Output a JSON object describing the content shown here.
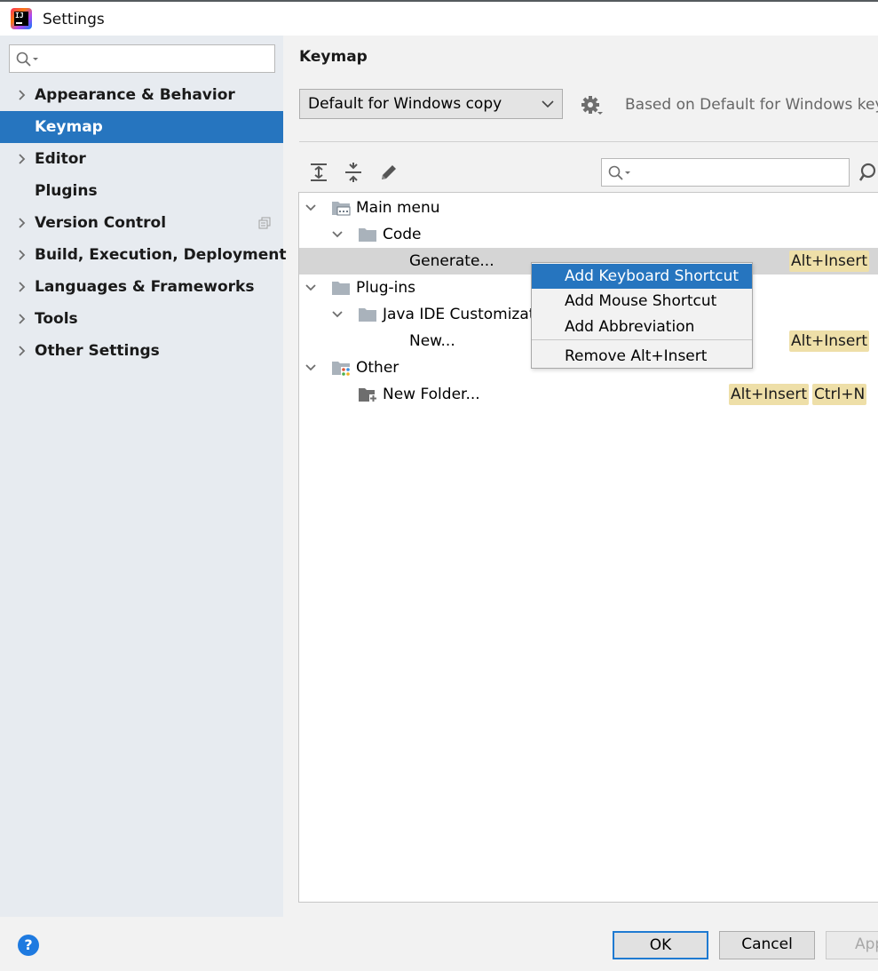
{
  "window": {
    "title": "Settings",
    "logo_text": "IJ"
  },
  "sidebar": {
    "search_placeholder": "",
    "items": [
      {
        "label": "Appearance & Behavior",
        "expandable": true
      },
      {
        "label": "Keymap",
        "expandable": false,
        "selected": true
      },
      {
        "label": "Editor",
        "expandable": true
      },
      {
        "label": "Plugins",
        "expandable": false
      },
      {
        "label": "Version Control",
        "expandable": true
      },
      {
        "label": "Build, Execution, Deployment",
        "expandable": true
      },
      {
        "label": "Languages & Frameworks",
        "expandable": true
      },
      {
        "label": "Tools",
        "expandable": true
      },
      {
        "label": "Other Settings",
        "expandable": true
      }
    ]
  },
  "main": {
    "title": "Keymap",
    "keymap_select": "Default for Windows copy",
    "based_on": "Based on Default for Windows keym",
    "tree_search_placeholder": ""
  },
  "tree": {
    "rows": [
      {
        "label": "Main menu"
      },
      {
        "label": "Code"
      },
      {
        "label": "Generate...",
        "shortcut": "Alt+Insert"
      },
      {
        "label": "Plug-ins"
      },
      {
        "label": "Java IDE Customizati"
      },
      {
        "label": "New...",
        "shortcut": "Alt+Insert"
      },
      {
        "label": "Other"
      },
      {
        "label": "New Folder...",
        "shortcuts": [
          "Alt+Insert",
          "Ctrl+N"
        ]
      }
    ]
  },
  "context_menu": {
    "items": [
      {
        "label": "Add Keyboard Shortcut"
      },
      {
        "label": "Add Mouse Shortcut"
      },
      {
        "label": "Add Abbreviation"
      },
      {
        "label": "Remove Alt+Insert"
      }
    ]
  },
  "footer": {
    "help_label": "?",
    "ok_label": "OK",
    "cancel_label": "Cancel",
    "apply_label": "App"
  },
  "colors": {
    "accent": "#2675bf",
    "sidebar_bg": "#e7ebf0",
    "shortcut_bg": "#eedfa8",
    "selected_row_bg": "#d5d5d5"
  }
}
